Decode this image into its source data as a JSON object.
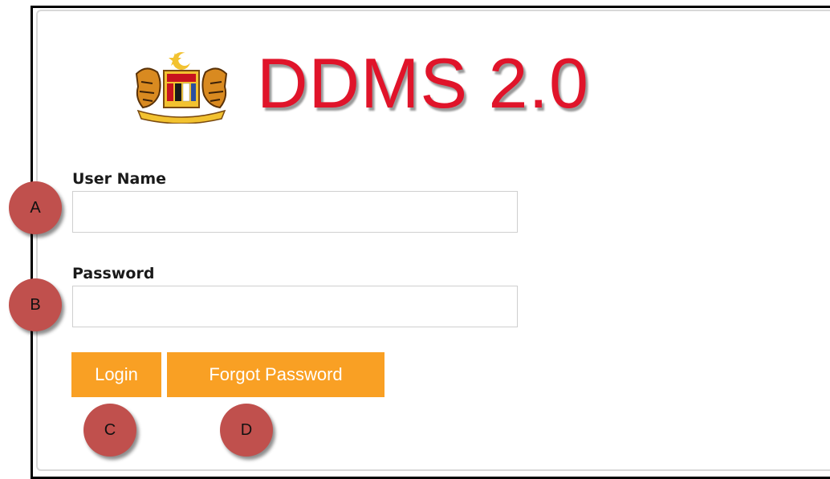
{
  "app": {
    "title": "DDMS 2.0",
    "brand_color": "#e0142a",
    "emblem_icon": "malaysia-coat-of-arms-icon"
  },
  "form": {
    "username_label": "User Name",
    "username_value": "",
    "password_label": "Password",
    "password_value": "",
    "login_label": "Login",
    "forgot_label": "Forgot Password",
    "button_color": "#f9a024"
  },
  "markers": {
    "a": "A",
    "b": "B",
    "c": "C",
    "d": "D",
    "color": "#c0504d"
  }
}
